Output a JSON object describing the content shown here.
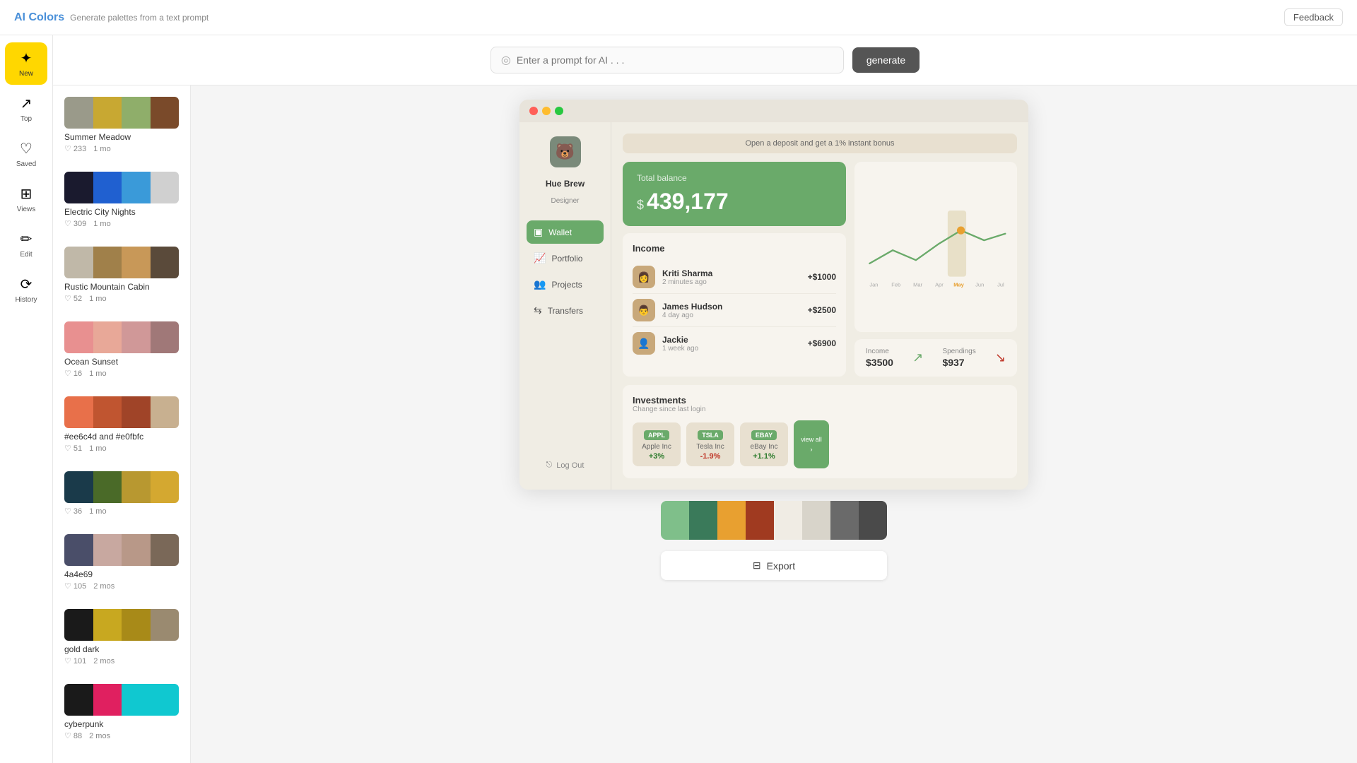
{
  "header": {
    "logo": "AI Colors",
    "tagline": "Generate palettes from a text prompt",
    "feedback_label": "Feedback"
  },
  "sidebar": {
    "items": [
      {
        "id": "new",
        "label": "New",
        "icon": "✦",
        "active": true
      },
      {
        "id": "top",
        "label": "Top",
        "icon": "↗"
      },
      {
        "id": "saved",
        "label": "Saved",
        "icon": "♡"
      },
      {
        "id": "views",
        "label": "Views",
        "icon": "⊞"
      },
      {
        "id": "edit",
        "label": "Edit",
        "icon": "✏"
      },
      {
        "id": "history",
        "label": "History",
        "icon": "⟳"
      }
    ]
  },
  "prompt": {
    "placeholder": "Enter a prompt for AI . . .",
    "generate_label": "generate"
  },
  "palettes": [
    {
      "name": "Summer Meadow",
      "likes": "233",
      "time": "1 mo",
      "swatches": [
        "#9a9a8a",
        "#c8a832",
        "#8fae6a",
        "#7a4a2a"
      ]
    },
    {
      "name": "Electric City Nights",
      "likes": "309",
      "time": "1 mo",
      "swatches": [
        "#1a1a2e",
        "#2060d0",
        "#3a9ad9",
        "#d0d0d0"
      ]
    },
    {
      "name": "Rustic Mountain Cabin",
      "likes": "52",
      "time": "1 mo",
      "swatches": [
        "#c0b8a8",
        "#a0804a",
        "#c89858",
        "#5a4a3a"
      ]
    },
    {
      "name": "Ocean Sunset",
      "likes": "16",
      "time": "1 mo",
      "swatches": [
        "#e89090",
        "#e8a898",
        "#d09898",
        "#a07878"
      ]
    },
    {
      "name": "#ee6c4d and #e0fbfc",
      "likes": "51",
      "time": "1 mo",
      "swatches": [
        "#e8704a",
        "#c05530",
        "#a04428",
        "#c8b090"
      ]
    },
    {
      "name": "",
      "likes": "36",
      "time": "1 mo",
      "swatches": [
        "#1a3a4a",
        "#4a6a28",
        "#b89830",
        "#d4a830"
      ]
    },
    {
      "name": "4a4e69",
      "likes": "105",
      "time": "2 mos",
      "swatches": [
        "#4a4e69",
        "#c8a8a0",
        "#b89888",
        "#7a6858"
      ]
    },
    {
      "name": "gold dark",
      "likes": "101",
      "time": "2 mos",
      "swatches": [
        "#1a1a1a",
        "#c8a820",
        "#a88a18",
        "#9a8a70"
      ]
    },
    {
      "name": "cyberpunk",
      "likes": "88",
      "time": "2 mos",
      "swatches": [
        "#1a1a1a",
        "#e02060",
        "#10c8d0",
        "#10c8d0"
      ]
    }
  ],
  "app_window": {
    "user_name": "Hue Brew",
    "user_role": "Designer",
    "deposit_banner": "Open a deposit and get a 1% instant bonus",
    "nav": [
      {
        "id": "wallet",
        "label": "Wallet",
        "active": true
      },
      {
        "id": "portfolio",
        "label": "Portfolio"
      },
      {
        "id": "projects",
        "label": "Projects"
      },
      {
        "id": "transfers",
        "label": "Transfers"
      }
    ],
    "logout_label": "Log Out",
    "balance": {
      "label": "Total balance",
      "currency": "$",
      "amount": "439,177"
    },
    "income": {
      "title": "Income",
      "rows": [
        {
          "name": "Kriti Sharma",
          "time": "2 minutes ago",
          "amount": "+$1000"
        },
        {
          "name": "James Hudson",
          "time": "4 day ago",
          "amount": "+$2500"
        },
        {
          "name": "Jackie",
          "time": "1 week ago",
          "amount": "+$6900"
        }
      ]
    },
    "stats": {
      "income_label": "Income",
      "income_value": "$3500",
      "spendings_label": "Spendings",
      "spendings_value": "$937"
    },
    "investments": {
      "title": "Investments",
      "subtitle": "Change since last login",
      "cards": [
        {
          "tag": "APPL",
          "company": "Apple Inc",
          "change": "+3%",
          "positive": true
        },
        {
          "tag": "TSLA",
          "company": "Tesla Inc",
          "change": "-1.9%",
          "positive": false
        },
        {
          "tag": "EBAY",
          "company": "eBay Inc",
          "change": "+1.1%",
          "positive": true
        }
      ],
      "view_all": "view all"
    },
    "chart_months": [
      "Jan",
      "Feb",
      "Mar",
      "Apr",
      "May",
      "Jun",
      "Jul"
    ]
  },
  "bottom_palette": {
    "swatches": [
      "#7fbf8a",
      "#3a7a5a",
      "#e8a030",
      "#a03a20",
      "#f0ece4",
      "#d8d4ca",
      "#6a6a6a",
      "#4a4a4a"
    ]
  },
  "export": {
    "label": "Export",
    "icon": "⊟"
  }
}
